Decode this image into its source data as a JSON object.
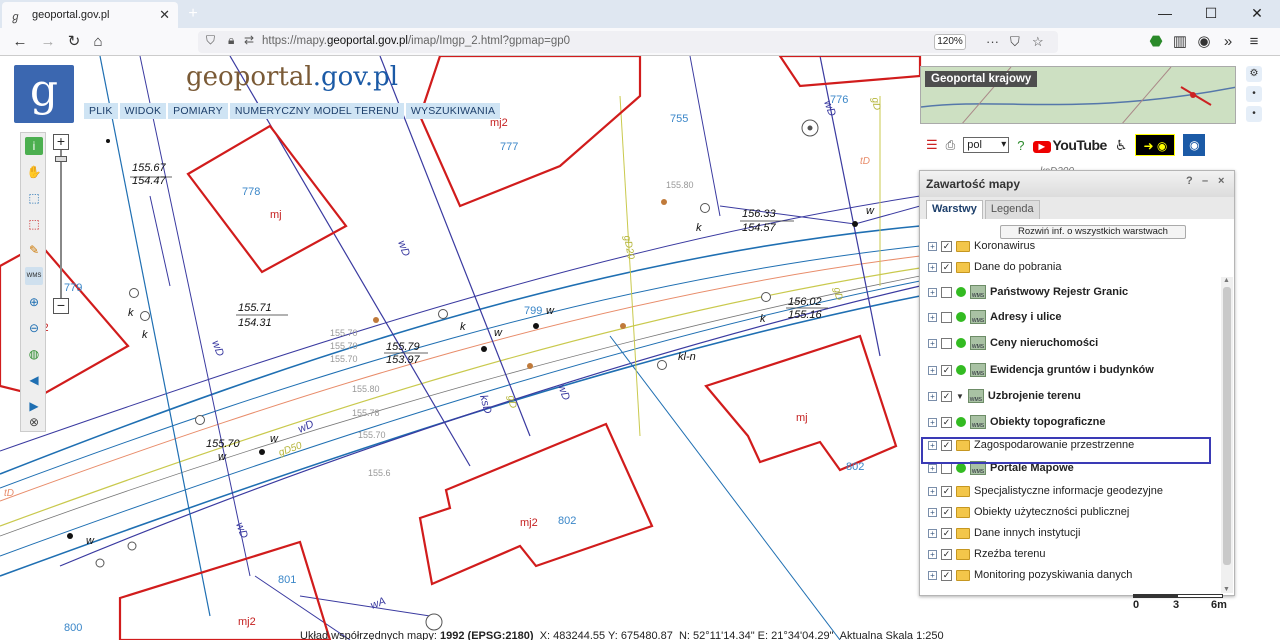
{
  "browser": {
    "tab_title": "geoportal.gov.pl",
    "new_tab": "+",
    "url_host": "https://mapy.",
    "url_domain": "geoportal.gov.pl",
    "url_path": "/imap/Imgp_2.html?gpmap=gp0",
    "zoom": "120%",
    "window_min": "—",
    "window_max": "☐",
    "window_close": "✕"
  },
  "header": {
    "logo_letter": "g",
    "brand_geo": "geoportal",
    "brand_gov": ".gov.pl"
  },
  "menu": [
    "PLIK",
    "WIDOK",
    "POMIARY",
    "NUMERYCZNY MODEL TERENU",
    "WYSZUKIWANIA"
  ],
  "minimap": {
    "label": "Geoportal krajowy"
  },
  "toolrow": {
    "language": "pol",
    "youtube": "YouTube"
  },
  "panel": {
    "title": "Zawartość mapy",
    "controls": [
      "?",
      "–",
      "×"
    ],
    "tabs": [
      "Warstwy",
      "Legenda"
    ],
    "active_tab": "Warstwy",
    "expand_button": "Rozwiń inf. o wszystkich warstwach",
    "layers": [
      {
        "name": "Koronawirus",
        "checked": true,
        "type": "folder"
      },
      {
        "name": "Dane do pobrania",
        "checked": true,
        "type": "folder"
      },
      {
        "name": "Państwowy Rejestr Granic",
        "checked": false,
        "type": "wms"
      },
      {
        "name": "Adresy i ulice",
        "checked": false,
        "type": "wms"
      },
      {
        "name": "Ceny nieruchomości",
        "checked": false,
        "type": "wms"
      },
      {
        "name": "Ewidencja gruntów i budynków",
        "checked": true,
        "type": "wms"
      },
      {
        "name": "Uzbrojenie terenu",
        "checked": true,
        "type": "wms-expanded"
      },
      {
        "name": "Obiekty topograficzne",
        "checked": true,
        "type": "wms"
      },
      {
        "name": "Zagospodarowanie przestrzenne",
        "checked": true,
        "type": "folder"
      },
      {
        "name": "Portale Mapowe",
        "checked": false,
        "type": "wms"
      },
      {
        "name": "Specjalistyczne informacje geodezyjne",
        "checked": true,
        "type": "folder"
      },
      {
        "name": "Obiekty użyteczności publicznej",
        "checked": true,
        "type": "folder"
      },
      {
        "name": "Dane innych instytucji",
        "checked": true,
        "type": "folder"
      },
      {
        "name": "Rzeźba terenu",
        "checked": true,
        "type": "folder"
      },
      {
        "name": "Monitoring pozyskiwania danych",
        "checked": true,
        "type": "folder"
      }
    ]
  },
  "scale": {
    "labels": [
      "0",
      "3",
      "6m"
    ]
  },
  "status": {
    "text_start": "Układ współrzędnych mapy: ",
    "crs": "1992 (EPSG:2180)",
    "xy": "X: 483244.55 Y: 675480.87",
    "nle": "N: 52°11'14.34\" E: 21°34'04.29\"",
    "scale_text": "Aktualna Skala 1:250"
  },
  "map_labels": {
    "parcels": [
      "777",
      "778",
      "779",
      "755",
      "776",
      "799",
      "802",
      "801",
      "800"
    ],
    "buildings": [
      "mj2",
      "mj",
      "mj2",
      "mj",
      "mj2",
      "mj2",
      "mj2"
    ],
    "heights": [
      "155.67",
      "154.47",
      "155.71",
      "154.31",
      "155.79",
      "153.97",
      "156.33",
      "154.57",
      "156.02",
      "155.16",
      "155.70"
    ],
    "utility": [
      "wD",
      "wA",
      "gD",
      "tD",
      "kSD",
      "ksD200",
      "gD50",
      "gD20",
      "kl-n",
      "w",
      "k"
    ]
  },
  "colors": {
    "building": "#d11c1c",
    "parcel_line": "#2f2fa8",
    "road_line": "#1f6fb2",
    "gas": "#c9c94d",
    "heating": "#e88c6a",
    "accent": "#3a3ab5"
  }
}
